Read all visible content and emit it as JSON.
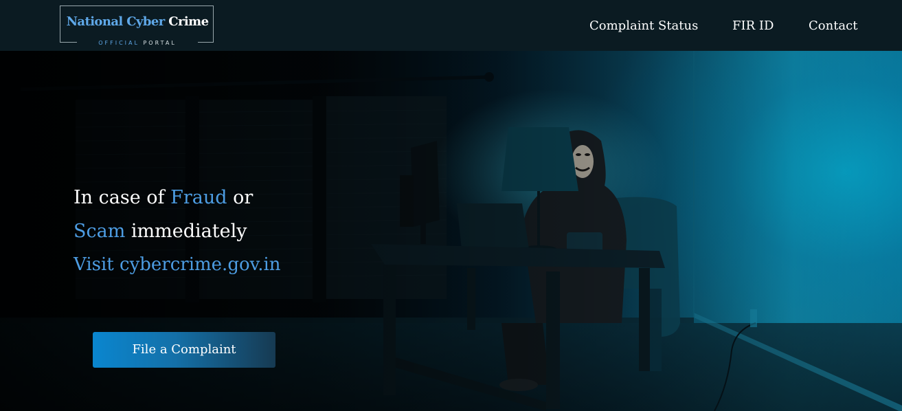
{
  "header": {
    "logo": {
      "title_part1": "National Cyber",
      "title_part2": "Crime",
      "subtitle_part1": "OFFICIAL",
      "subtitle_part2": "PORTAL"
    },
    "nav": {
      "complaint_status": "Complaint Status",
      "fir_id": "FIR ID",
      "contact": "Contact"
    }
  },
  "hero": {
    "line1_prefix": "In case of",
    "line1_highlight": "Fraud",
    "line1_suffix": "or",
    "line2_highlight": "Scam",
    "line2_suffix": "immediately",
    "line3": "Visit cybercrime.gov.in",
    "cta_label": "File a Complaint"
  },
  "colors": {
    "header_bg": "#0b1b22",
    "accent_blue": "#4d9de3",
    "scene_teal": "#1287a6"
  },
  "icons": {
    "background": "hooded-hacker-at-desk-illustration"
  }
}
